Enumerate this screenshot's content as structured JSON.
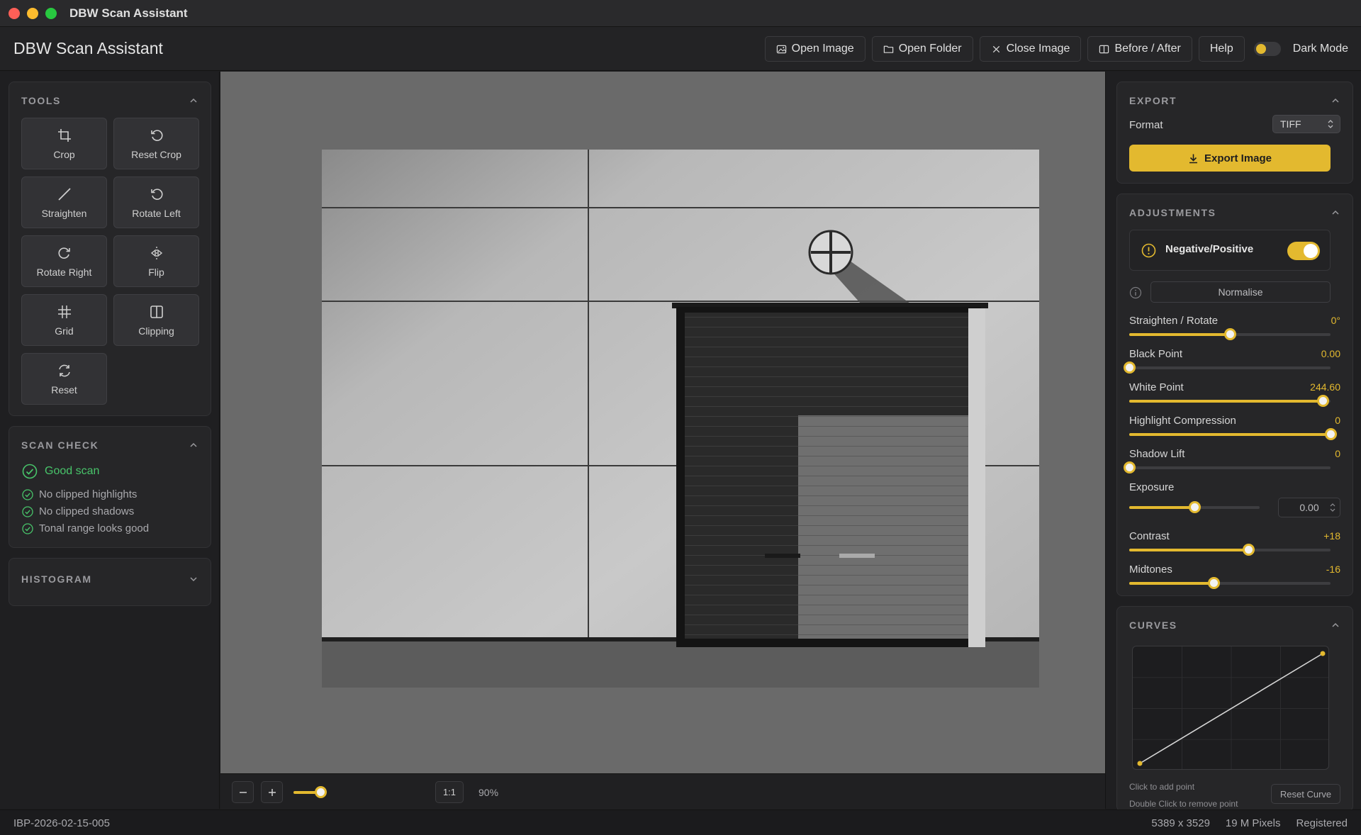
{
  "window": {
    "title": "DBW Scan Assistant"
  },
  "header": {
    "app_title": "DBW Scan Assistant",
    "buttons": {
      "open_image": "Open Image",
      "open_folder": "Open Folder",
      "close_image": "Close Image",
      "before_after": "Before / After",
      "help": "Help"
    },
    "dark_mode_label": "Dark Mode"
  },
  "tools": {
    "title": "TOOLS",
    "items": [
      {
        "label": "Crop",
        "icon": "crop-icon"
      },
      {
        "label": "Reset Crop",
        "icon": "reset-crop-icon"
      },
      {
        "label": "Straighten",
        "icon": "straighten-icon"
      },
      {
        "label": "Rotate Left",
        "icon": "rotate-left-icon"
      },
      {
        "label": "Rotate Right",
        "icon": "rotate-right-icon"
      },
      {
        "label": "Flip",
        "icon": "flip-icon"
      },
      {
        "label": "Grid",
        "icon": "grid-icon"
      },
      {
        "label": "Clipping",
        "icon": "clipping-icon"
      },
      {
        "label": "Reset",
        "icon": "reset-icon"
      }
    ]
  },
  "scan_check": {
    "title": "SCAN CHECK",
    "status": "Good scan",
    "checks": [
      "No clipped highlights",
      "No clipped shadows",
      "Tonal range looks good"
    ]
  },
  "histogram": {
    "title": "HISTOGRAM"
  },
  "zoom": {
    "one_to_one": "1:1",
    "level": "90%",
    "slider_fraction": 0.9
  },
  "export": {
    "title": "EXPORT",
    "format_label": "Format",
    "format_value": "TIFF",
    "export_button": "Export Image"
  },
  "adjustments": {
    "title": "ADJUSTMENTS",
    "negative_positive": "Negative/Positive",
    "negative_positive_on": true,
    "normalise": "Normalise",
    "sliders": [
      {
        "label": "Straighten / Rotate",
        "value": "0°",
        "fraction": 0.5
      },
      {
        "label": "Black Point",
        "value": "0.00",
        "fraction": 0.0
      },
      {
        "label": "White Point",
        "value": "244.60",
        "fraction": 0.96
      },
      {
        "label": "Highlight Compression",
        "value": "0",
        "fraction": 1.0
      },
      {
        "label": "Shadow Lift",
        "value": "0",
        "fraction": 0.0
      },
      {
        "label": "Exposure",
        "value": "0.00",
        "fraction": 0.5
      },
      {
        "label": "Contrast",
        "value": "+18",
        "fraction": 0.59
      },
      {
        "label": "Midtones",
        "value": "-16",
        "fraction": 0.42
      }
    ]
  },
  "curves": {
    "title": "CURVES",
    "hint_add": "Click to add point",
    "hint_remove": "Double Click to remove point",
    "reset": "Reset Curve"
  },
  "status": {
    "file_name": "IBP-2026-02-15-005",
    "dimensions": "5389 x 3529",
    "megapixels": "19 M Pixels",
    "registration": "Registered"
  },
  "colors": {
    "accent": "#e3b92f",
    "success": "#48c46a",
    "background": "#1d1d1f"
  }
}
